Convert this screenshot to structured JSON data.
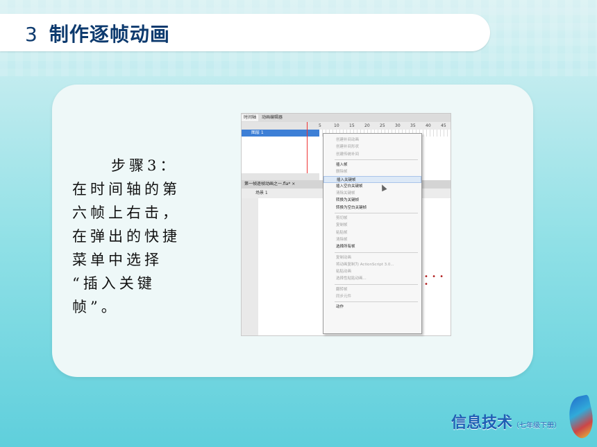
{
  "title": {
    "number": "3",
    "text": "制作逐帧动画"
  },
  "step": {
    "heading": "步骤3：",
    "lines": [
      "在时间轴的第",
      "六帧上右击，",
      "在弹出的快捷",
      "菜单中选择",
      "“插入关键",
      "帧”。"
    ]
  },
  "flash": {
    "tabs": [
      "时间轴",
      "动画编辑器"
    ],
    "ruler": [
      "5",
      "10",
      "15",
      "20",
      "25",
      "30",
      "35",
      "40",
      "45"
    ],
    "layer": "图层 1",
    "doc_tab": "第一帧逐帧动画之一.fla* ×",
    "scene": "场景 1"
  },
  "context_menu": {
    "items": [
      {
        "label": "创建补间动画",
        "enabled": false
      },
      {
        "label": "创建补间形状",
        "enabled": false
      },
      {
        "label": "创建传统补间",
        "enabled": false
      },
      {
        "sep": true
      },
      {
        "label": "插入帧",
        "enabled": true
      },
      {
        "label": "删除帧",
        "enabled": false
      },
      {
        "label": "插入关键帧",
        "enabled": true,
        "highlight": true
      },
      {
        "label": "插入空白关键帧",
        "enabled": true
      },
      {
        "label": "清除关键帧",
        "enabled": false
      },
      {
        "label": "转换为关键帧",
        "enabled": true
      },
      {
        "label": "转换为空白关键帧",
        "enabled": true
      },
      {
        "sep": true
      },
      {
        "label": "剪切帧",
        "enabled": false
      },
      {
        "label": "复制帧",
        "enabled": false
      },
      {
        "label": "粘贴帧",
        "enabled": false
      },
      {
        "label": "清除帧",
        "enabled": false
      },
      {
        "label": "选择所有帧",
        "enabled": true
      },
      {
        "sep": true
      },
      {
        "label": "复制动画",
        "enabled": false
      },
      {
        "label": "将动画复制为 ActionScript 3.0...",
        "enabled": false
      },
      {
        "label": "粘贴动画",
        "enabled": false
      },
      {
        "label": "选择性粘贴动画...",
        "enabled": false
      },
      {
        "sep": true
      },
      {
        "label": "翻转帧",
        "enabled": false
      },
      {
        "label": "同步元件",
        "enabled": false
      },
      {
        "sep": true
      },
      {
        "label": "动作",
        "enabled": true
      }
    ]
  },
  "logo": {
    "main": "信息技术",
    "sub": "（七年级下册）"
  },
  "colors": {
    "title": "#0d3a6e",
    "highlight": "#dde9f7"
  }
}
